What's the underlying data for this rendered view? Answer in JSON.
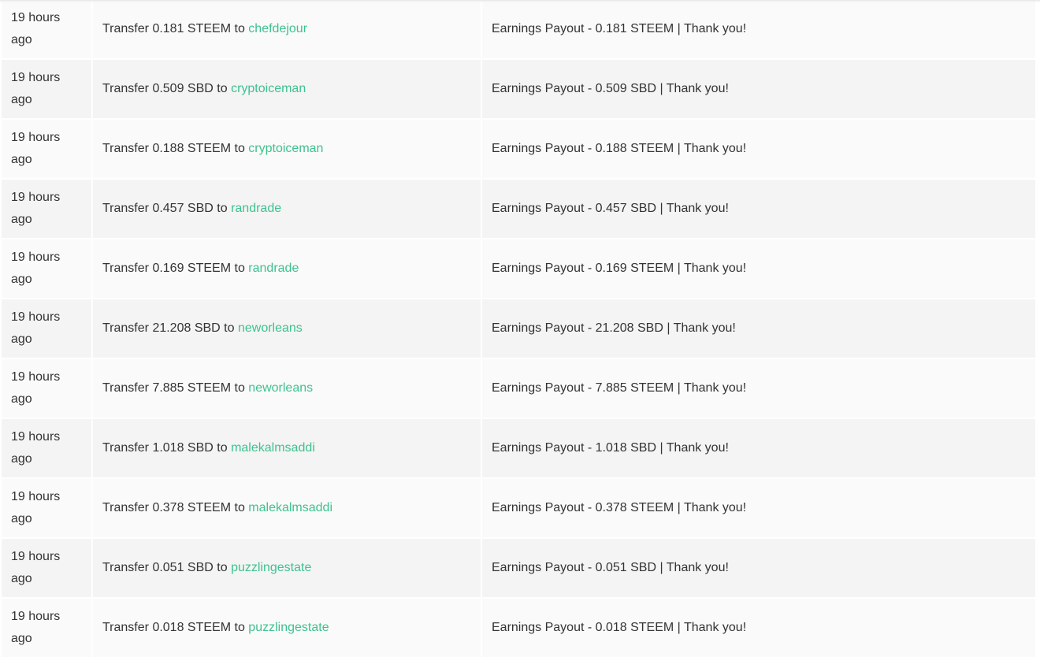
{
  "transfers": [
    {
      "time": "19 hours ago",
      "prefix": "Transfer",
      "amount": "0.181 STEEM",
      "to": "to",
      "user": "chefdejour",
      "memo": "Earnings Payout - 0.181 STEEM | Thank you!"
    },
    {
      "time": "19 hours ago",
      "prefix": "Transfer",
      "amount": "0.509 SBD",
      "to": "to",
      "user": "cryptoiceman",
      "memo": "Earnings Payout - 0.509 SBD | Thank you!"
    },
    {
      "time": "19 hours ago",
      "prefix": "Transfer",
      "amount": "0.188 STEEM",
      "to": "to",
      "user": "cryptoiceman",
      "memo": "Earnings Payout - 0.188 STEEM | Thank you!"
    },
    {
      "time": "19 hours ago",
      "prefix": "Transfer",
      "amount": "0.457 SBD",
      "to": "to",
      "user": "randrade",
      "memo": "Earnings Payout - 0.457 SBD | Thank you!"
    },
    {
      "time": "19 hours ago",
      "prefix": "Transfer",
      "amount": "0.169 STEEM",
      "to": "to",
      "user": "randrade",
      "memo": "Earnings Payout - 0.169 STEEM | Thank you!"
    },
    {
      "time": "19 hours ago",
      "prefix": "Transfer",
      "amount": "21.208 SBD",
      "to": "to",
      "user": "neworleans",
      "memo": "Earnings Payout - 21.208 SBD | Thank you!"
    },
    {
      "time": "19 hours ago",
      "prefix": "Transfer",
      "amount": "7.885 STEEM",
      "to": "to",
      "user": "neworleans",
      "memo": "Earnings Payout - 7.885 STEEM | Thank you!"
    },
    {
      "time": "19 hours ago",
      "prefix": "Transfer",
      "amount": "1.018 SBD",
      "to": "to",
      "user": "malekalmsaddi",
      "memo": "Earnings Payout - 1.018 SBD | Thank you!"
    },
    {
      "time": "19 hours ago",
      "prefix": "Transfer",
      "amount": "0.378 STEEM",
      "to": "to",
      "user": "malekalmsaddi",
      "memo": "Earnings Payout - 0.378 STEEM | Thank you!"
    },
    {
      "time": "19 hours ago",
      "prefix": "Transfer",
      "amount": "0.051 SBD",
      "to": "to",
      "user": "puzzlingestate",
      "memo": "Earnings Payout - 0.051 SBD | Thank you!"
    },
    {
      "time": "19 hours ago",
      "prefix": "Transfer",
      "amount": "0.018 STEEM",
      "to": "to",
      "user": "puzzlingestate",
      "memo": "Earnings Payout - 0.018 STEEM | Thank you!"
    }
  ],
  "colors": {
    "link": "#3ec28f",
    "row_odd": "#fafafa",
    "row_even": "#f4f4f4",
    "text": "#333333"
  }
}
